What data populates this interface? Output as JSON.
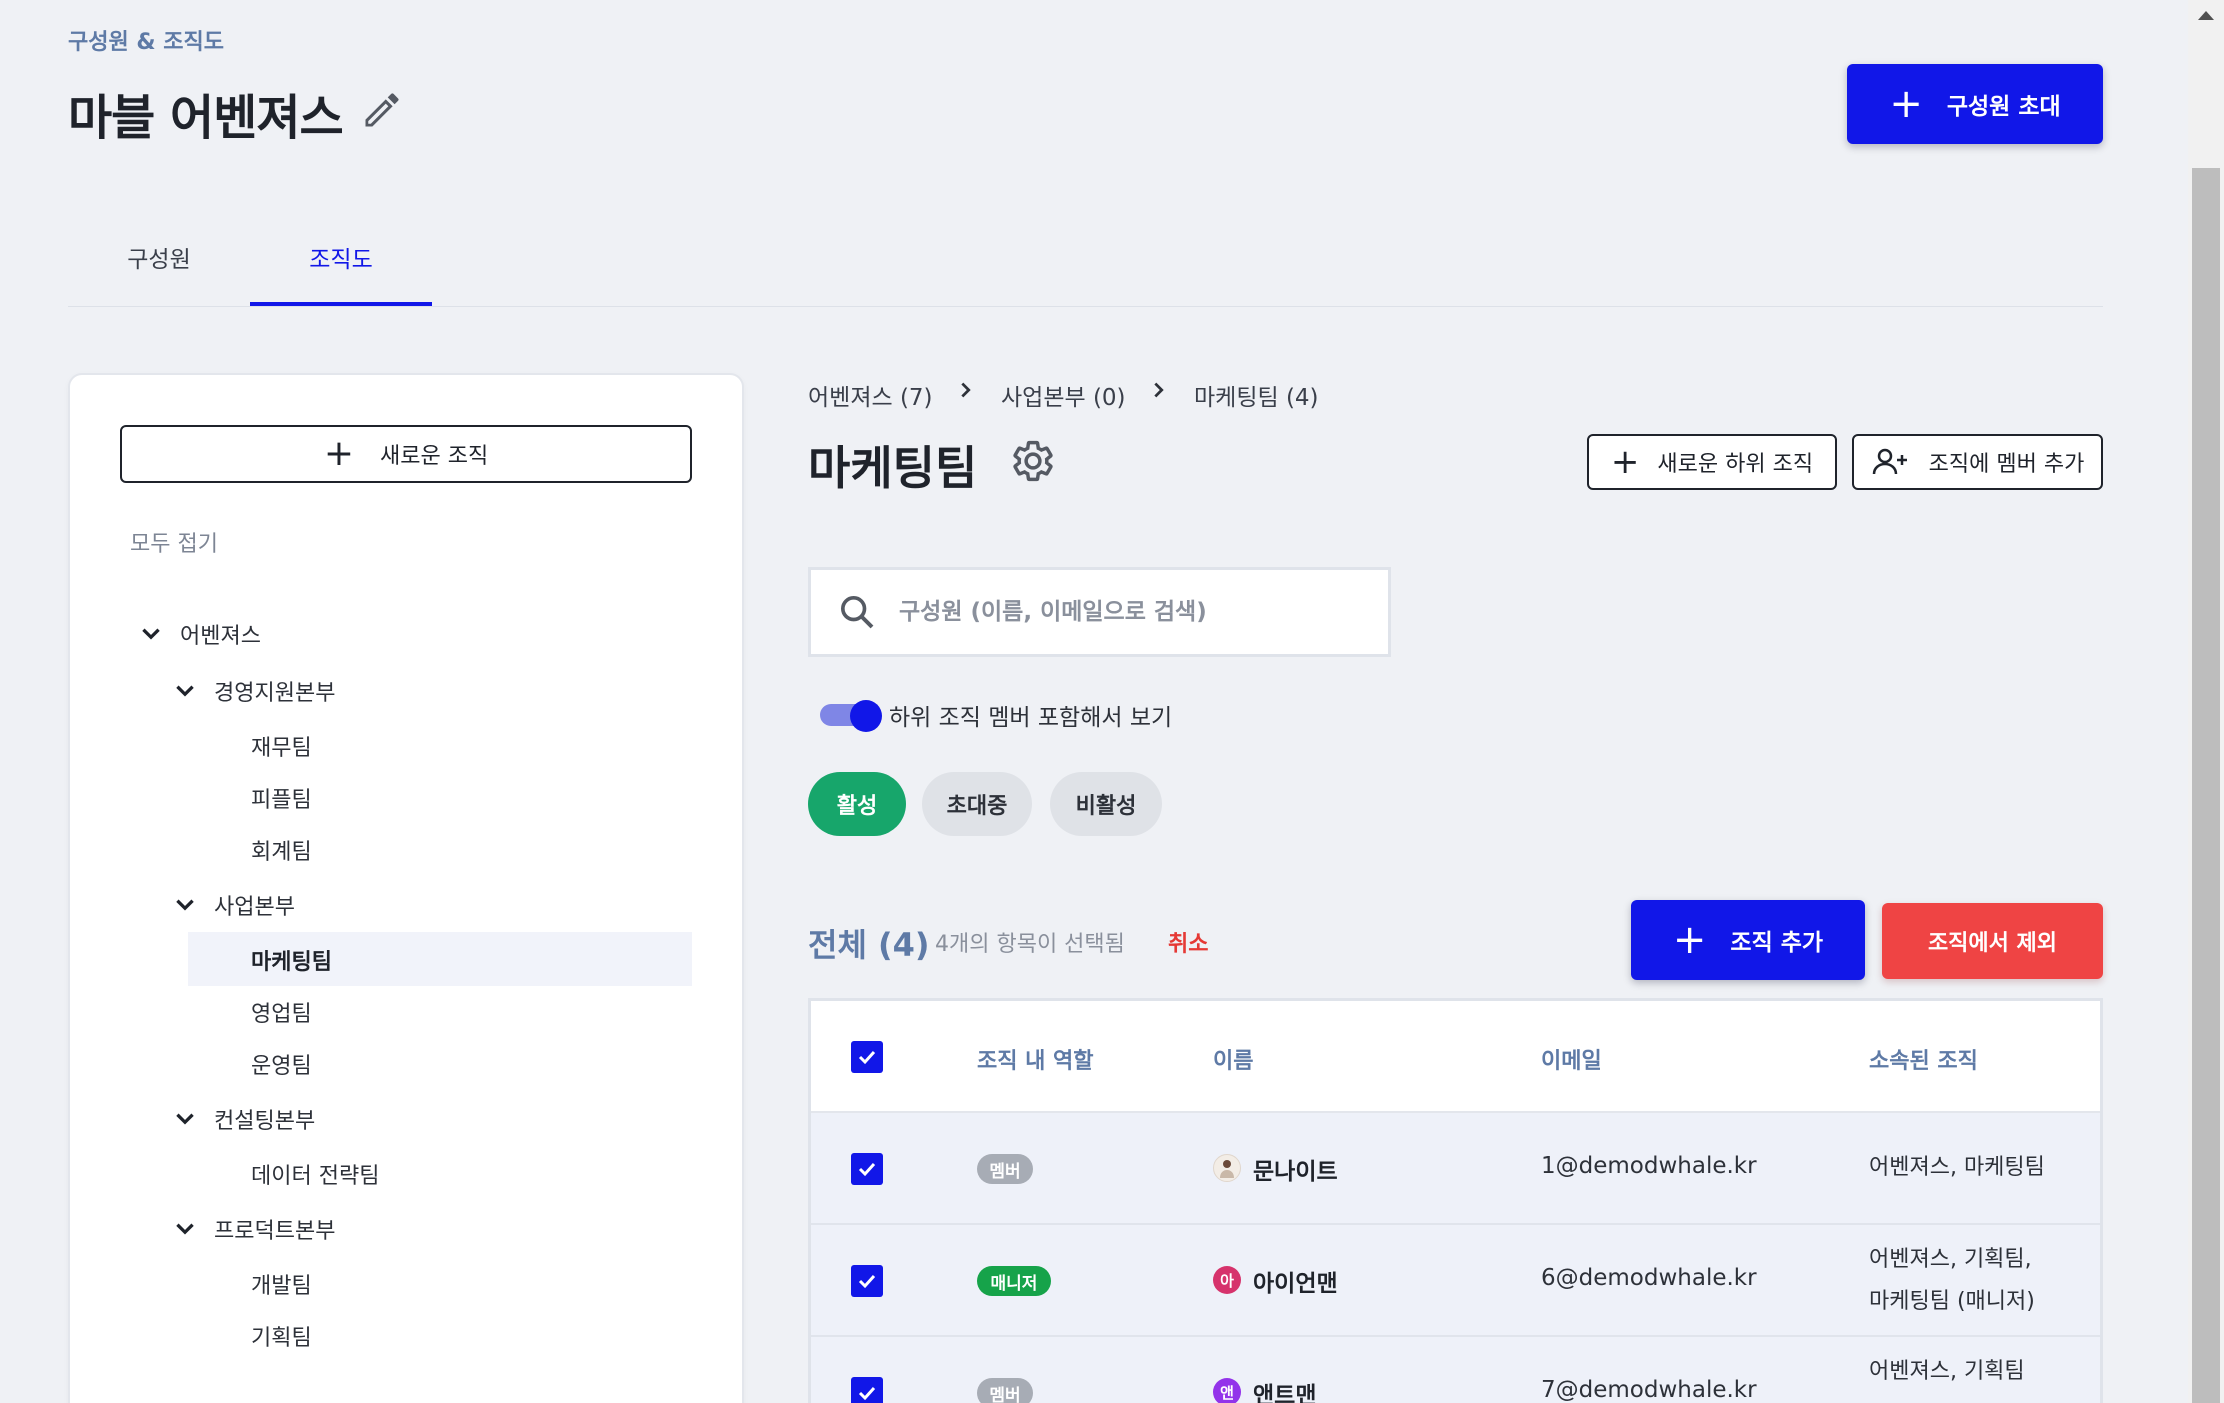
{
  "header": {
    "breadcrumb": "구성원 & 조직도",
    "title": "마블 어벤져스",
    "invite_label": "구성원 초대"
  },
  "tabs": [
    {
      "label": "구성원",
      "active": false
    },
    {
      "label": "조직도",
      "active": true
    }
  ],
  "tree": {
    "new_org_label": "새로운 조직",
    "collapse_all_label": "모두 접기",
    "nodes": [
      {
        "label": "어벤져스",
        "level": 0,
        "expanded": true
      },
      {
        "label": "경영지원본부",
        "level": 1,
        "expanded": true
      },
      {
        "label": "재무팀",
        "level": 2
      },
      {
        "label": "피플팀",
        "level": 2
      },
      {
        "label": "회계팀",
        "level": 2
      },
      {
        "label": "사업본부",
        "level": 1,
        "expanded": true
      },
      {
        "label": "마케팅팀",
        "level": 2,
        "selected": true
      },
      {
        "label": "영업팀",
        "level": 2
      },
      {
        "label": "운영팀",
        "level": 2
      },
      {
        "label": "컨설팅본부",
        "level": 1,
        "expanded": true
      },
      {
        "label": "데이터 전략팀",
        "level": 2
      },
      {
        "label": "프로덕트본부",
        "level": 1,
        "expanded": true
      },
      {
        "label": "개발팀",
        "level": 2
      },
      {
        "label": "기획팀",
        "level": 2
      }
    ]
  },
  "breadcrumb": [
    "어벤져스 (7)",
    "사업본부 (0)",
    "마케팅팀 (4)"
  ],
  "team": {
    "title": "마케팅팀",
    "new_sub_org_label": "새로운 하위 조직",
    "add_member_label": "조직에 멤버 추가"
  },
  "search": {
    "placeholder": "구성원 (이름, 이메일으로 검색)",
    "value": ""
  },
  "toggle": {
    "label": "하위 조직 멤버 포함해서 보기",
    "on": true
  },
  "filters": [
    {
      "label": "활성",
      "active": true
    },
    {
      "label": "초대중",
      "active": false
    },
    {
      "label": "비활성",
      "active": false
    }
  ],
  "list": {
    "total_label": "전체 (4)",
    "selected_info": "4개의 항목이 선택됨",
    "cancel_label": "취소",
    "add_org_label": "조직 추가",
    "remove_label": "조직에서 제외"
  },
  "table": {
    "columns": [
      "조직 내 역할",
      "이름",
      "이메일",
      "소속된 조직"
    ],
    "rows": [
      {
        "checked": true,
        "role": "멤버",
        "avatar": "",
        "name": "문나이트",
        "email": "1@demodwhale.kr",
        "orgs": [
          "어벤져스, 마케팅팀"
        ]
      },
      {
        "checked": true,
        "role": "매니저",
        "avatar": "아",
        "name": "아이언맨",
        "email": "6@demodwhale.kr",
        "orgs": [
          "어벤져스, 기획팀,",
          "마케팅팀 (매니저)"
        ]
      },
      {
        "checked": true,
        "role": "멤버",
        "avatar": "앤",
        "name": "앤트맨",
        "email": "7@demodwhale.kr",
        "orgs": [
          "어벤져스, 기획팀",
          ""
        ]
      }
    ]
  },
  "colors": {
    "primary": "#1117e8",
    "danger": "#ef4444",
    "success": "#17a66b",
    "muted_blue": "#5e7aa6",
    "background": "#eff1f5"
  }
}
